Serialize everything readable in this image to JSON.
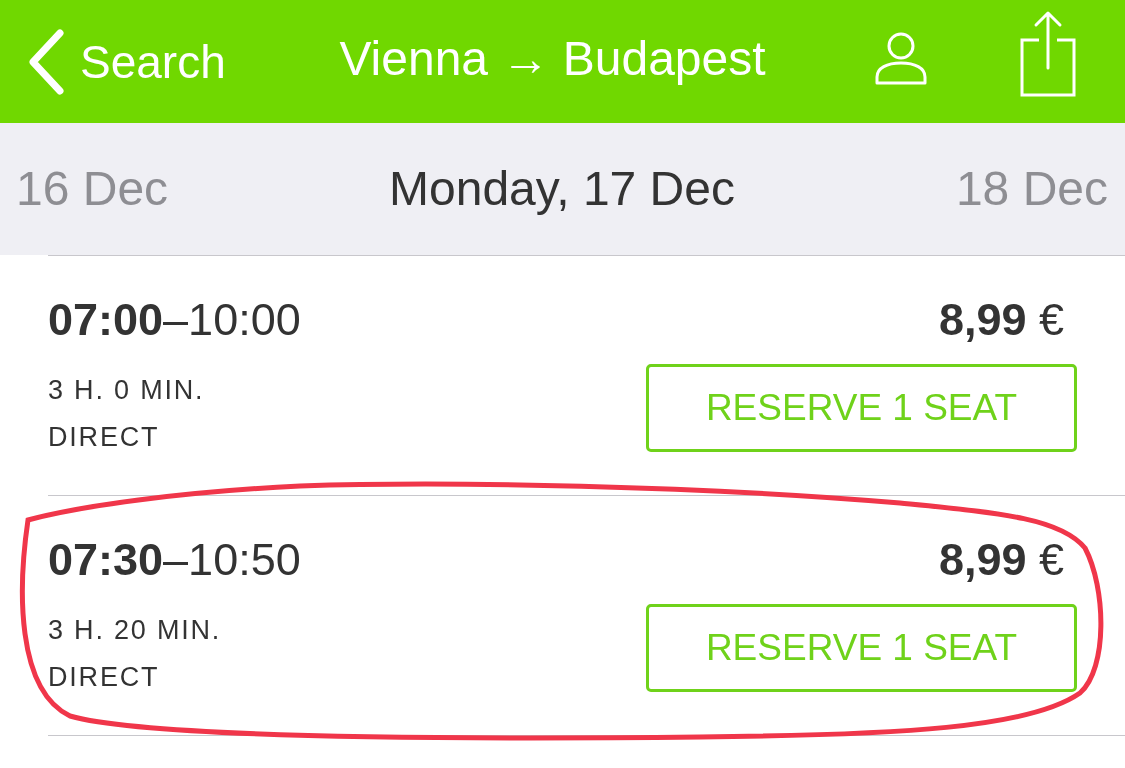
{
  "nav": {
    "back_label": "Search",
    "title": "Vienna → Budapest"
  },
  "date_bar": {
    "previous": "16 Dec",
    "current": "Monday, 17 Dec",
    "next": "18 Dec"
  },
  "connections": [
    {
      "times": "**07:00**–10:00",
      "duration": "3 H. 0 MIN.",
      "transfers": "DIRECT",
      "price": "**8,99** €",
      "button": "RESERVE 1 SEAT",
      "highlighted": false
    },
    {
      "times": "**07:30**–10:50",
      "duration": "3 H. 20 MIN.",
      "transfers": "DIRECT",
      "price": "**8,99** €",
      "button": "RESERVE 1 SEAT",
      "highlighted": true
    }
  ]
}
